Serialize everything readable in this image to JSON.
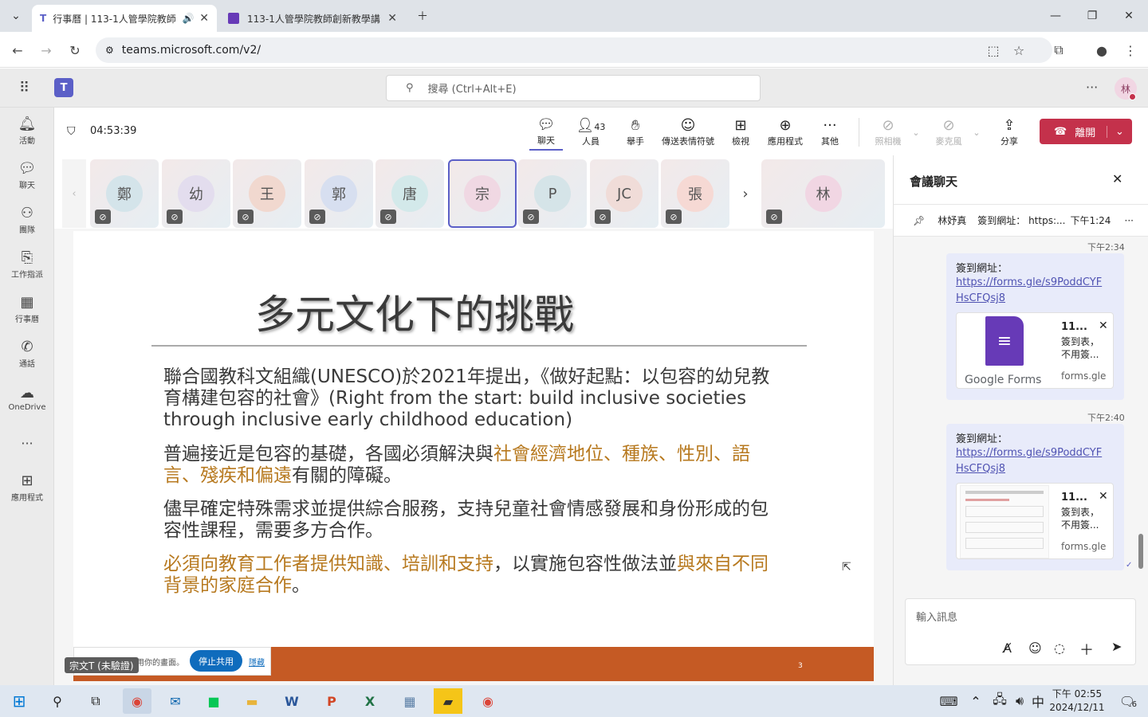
{
  "browser": {
    "tabs": [
      {
        "title": "行事曆 | 113-1人管學院教師",
        "active": true
      },
      {
        "title": "113-1人管學院教師創新教學講",
        "active": false
      }
    ],
    "url": "teams.microsoft.com/v2/"
  },
  "teams": {
    "search_placeholder": "搜尋 (Ctrl+Alt+E)",
    "avatar_initial": "林",
    "rail": [
      {
        "label": "活動",
        "icon": "bell-icon"
      },
      {
        "label": "聊天",
        "icon": "chat-icon"
      },
      {
        "label": "團隊",
        "icon": "teams-icon"
      },
      {
        "label": "工作指派",
        "icon": "backpack-icon"
      },
      {
        "label": "行事曆",
        "icon": "calendar-icon"
      },
      {
        "label": "通話",
        "icon": "phone-icon"
      },
      {
        "label": "OneDrive",
        "icon": "cloud-icon"
      },
      {
        "label": "應用程式",
        "icon": "apps-icon"
      }
    ]
  },
  "meeting": {
    "timer": "04:53:39",
    "toolbar": {
      "chat": "聊天",
      "people": "人員",
      "people_count": "43",
      "raise": "舉手",
      "react": "傳送表情符號",
      "view": "檢視",
      "apps": "應用程式",
      "more": "其他",
      "camera": "照相機",
      "mic": "麥克風",
      "share": "分享",
      "leave": "離開"
    },
    "participants": [
      {
        "initial": "鄭",
        "color": "#d4e4ea",
        "muted": true
      },
      {
        "initial": "幼",
        "color": "#e3ddee",
        "muted": true
      },
      {
        "initial": "王",
        "color": "#f1d8cf",
        "muted": true
      },
      {
        "initial": "郭",
        "color": "#d7dff0",
        "muted": true
      },
      {
        "initial": "唐",
        "color": "#d3e9ea",
        "muted": true
      },
      {
        "initial": "宗",
        "color": "#f0d8e3",
        "muted": false,
        "selected": true
      },
      {
        "initial": "P",
        "color": "#d5e4e8",
        "muted": true
      },
      {
        "initial": "JC",
        "color": "#f0dcd8",
        "muted": true
      },
      {
        "initial": "張",
        "color": "#f6d9d4",
        "muted": true
      },
      {
        "initial": "林",
        "color": "#f1d6e3",
        "muted": true
      }
    ],
    "slide": {
      "title": "多元文化下的挑戰",
      "p1": "聯合國教科文組織(UNESCO)於2021年提出，《做好起點：以包容的幼兒教育構建包容的社會》(Right from the start: build inclusive societies through inclusive early childhood education)",
      "p2_a": "普遍接近是包容的基礎，各國必須解決與",
      "p2_hl": "社會經濟地位、種族、性別、語言、殘疾和偏遠",
      "p2_b": "有關的障礙。",
      "p3": "儘早確定特殊需求並提供綜合服務，支持兒童社會情感發展和身份形成的包容性課程，需要多方合作。",
      "p4_hl": "必須向教育工作者提供知識、培訓和支持",
      "p4_b": "，以實施包容性做法並",
      "p4_hl2": "與來自不同背景的家庭合作",
      "p4_c": "。",
      "page": "3"
    },
    "share_note": "用你的畫面。",
    "stop_share": "停止共用",
    "hide": "隱藏",
    "presenter_name": "宗文T (未驗證)"
  },
  "chat": {
    "title": "會議聊天",
    "pinned_name": "林妤真",
    "pinned_text": "簽到網址： https:...",
    "pinned_time": "下午1:24",
    "messages": [
      {
        "time": "下午2:34",
        "label": "簽到網址：",
        "link": "https://forms.gle/s9PoddCYFHsCFQsj8",
        "card_title": "11...",
        "card_desc": "簽到表，不用簽...",
        "card_domain": "forms.gle",
        "card_brand": "Google Forms"
      },
      {
        "time": "下午2:40",
        "label": "簽到網址：",
        "link": "https://forms.gle/s9PoddCYFHsCFQsj8",
        "card_title": "11...",
        "card_desc": "簽到表，不用簽...",
        "card_domain": "forms.gle",
        "card_brand": ""
      }
    ],
    "composer_placeholder": "輸入訊息"
  },
  "taskbar": {
    "time": "下午 02:55",
    "date": "2024/12/11",
    "ime": "中",
    "notifications": "6"
  }
}
